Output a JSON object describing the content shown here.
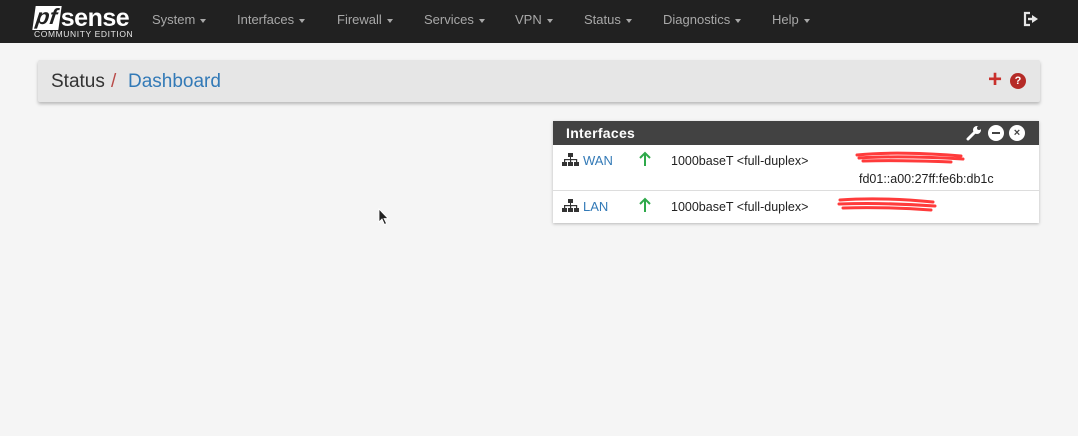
{
  "brand": {
    "logo_pf": "pf",
    "logo_sense": "sense",
    "edition": "COMMUNITY EDITION"
  },
  "nav": {
    "items": [
      {
        "label": "System"
      },
      {
        "label": "Interfaces"
      },
      {
        "label": "Firewall"
      },
      {
        "label": "Services"
      },
      {
        "label": "VPN"
      },
      {
        "label": "Status"
      },
      {
        "label": "Diagnostics"
      },
      {
        "label": "Help"
      }
    ],
    "logout_icon": "sign-out-icon"
  },
  "breadcrumb": {
    "section": "Status",
    "separator": "/",
    "page": "Dashboard",
    "add_icon": "+",
    "help_icon": "?"
  },
  "widget": {
    "title": "Interfaces",
    "icons": [
      "wrench-icon",
      "minus-circle-icon",
      "close-circle-icon"
    ],
    "close_glyph": "×",
    "rows": [
      {
        "name": "WAN",
        "status_icon": "arrow-up-icon",
        "media": "1000baseT <full-duplex>",
        "ipv6": "fd01::a00:27ff:fe6b:db1c"
      },
      {
        "name": "LAN",
        "status_icon": "arrow-up-icon",
        "media": "1000baseT <full-duplex>"
      }
    ]
  },
  "colors": {
    "navbar": "#212121",
    "accent_red": "#c9302c",
    "link_blue": "#337ab7",
    "status_up": "#2ea94a",
    "redaction": "#ff3b3b"
  }
}
